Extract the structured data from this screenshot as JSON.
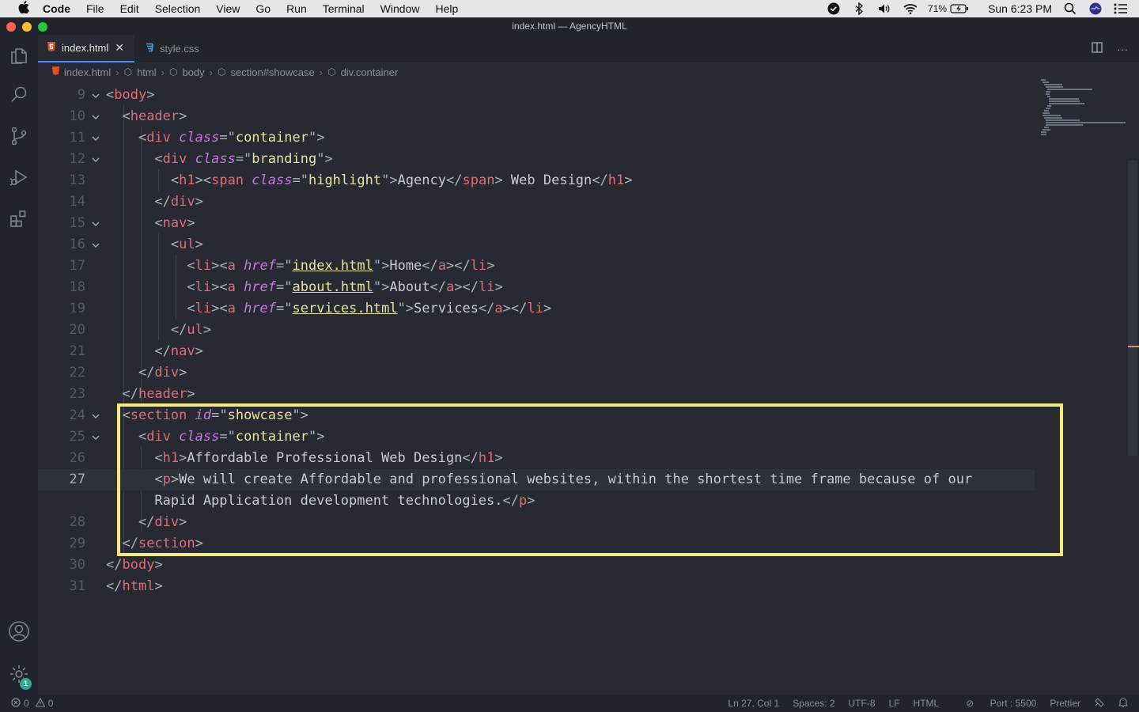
{
  "menubar": {
    "app": "Code",
    "items": [
      "File",
      "Edit",
      "Selection",
      "View",
      "Go",
      "Run",
      "Terminal",
      "Window",
      "Help"
    ],
    "battery": "71%",
    "clock": "Sun 6:23 PM"
  },
  "window": {
    "title": "index.html — AgencyHTML"
  },
  "activity_bar": {
    "items": [
      "explorer-icon",
      "search-icon",
      "source-control-icon",
      "run-debug-icon",
      "extensions-icon"
    ],
    "bottom": [
      "accounts-icon",
      "manage-gear-icon"
    ],
    "badge": "1"
  },
  "tabs": [
    {
      "label": "index.html",
      "icon": "html5-icon",
      "active": true
    },
    {
      "label": "style.css",
      "icon": "css3-icon",
      "active": false
    }
  ],
  "breadcrumb": [
    "index.html",
    "html",
    "body",
    "section#showcase",
    "div.container"
  ],
  "editor": {
    "lines": [
      {
        "num": "9",
        "fold": true,
        "tokens": [
          [
            "p",
            "<"
          ],
          [
            "t",
            "body"
          ],
          [
            "p",
            ">"
          ]
        ]
      },
      {
        "num": "10",
        "fold": true,
        "tokens": [
          [
            "p",
            "  <"
          ],
          [
            "t",
            "header"
          ],
          [
            "p",
            ">"
          ]
        ]
      },
      {
        "num": "11",
        "fold": true,
        "tokens": [
          [
            "p",
            "    <"
          ],
          [
            "t",
            "div"
          ],
          [
            "p",
            " "
          ],
          [
            "a",
            "class"
          ],
          [
            "p",
            "=\""
          ],
          [
            "s",
            "container"
          ],
          [
            "p",
            "\">"
          ]
        ]
      },
      {
        "num": "12",
        "fold": true,
        "tokens": [
          [
            "p",
            "      <"
          ],
          [
            "t",
            "div"
          ],
          [
            "p",
            " "
          ],
          [
            "a",
            "class"
          ],
          [
            "p",
            "=\""
          ],
          [
            "s",
            "branding"
          ],
          [
            "p",
            "\">"
          ]
        ]
      },
      {
        "num": "13",
        "fold": false,
        "tokens": [
          [
            "p",
            "        <"
          ],
          [
            "t",
            "h1"
          ],
          [
            "p",
            "><"
          ],
          [
            "t",
            "span"
          ],
          [
            "p",
            " "
          ],
          [
            "a",
            "class"
          ],
          [
            "p",
            "=\""
          ],
          [
            "s",
            "highlight"
          ],
          [
            "p",
            "\">"
          ],
          [
            "x",
            "Agency"
          ],
          [
            "p",
            "</"
          ],
          [
            "t",
            "span"
          ],
          [
            "p",
            "> "
          ],
          [
            "x",
            "Web Design"
          ],
          [
            "p",
            "</"
          ],
          [
            "t",
            "h1"
          ],
          [
            "p",
            ">"
          ]
        ]
      },
      {
        "num": "14",
        "fold": false,
        "tokens": [
          [
            "p",
            "      </"
          ],
          [
            "t",
            "div"
          ],
          [
            "p",
            ">"
          ]
        ]
      },
      {
        "num": "15",
        "fold": true,
        "tokens": [
          [
            "p",
            "      <"
          ],
          [
            "t",
            "nav"
          ],
          [
            "p",
            ">"
          ]
        ]
      },
      {
        "num": "16",
        "fold": true,
        "tokens": [
          [
            "p",
            "        <"
          ],
          [
            "t",
            "ul"
          ],
          [
            "p",
            ">"
          ]
        ]
      },
      {
        "num": "17",
        "fold": false,
        "tokens": [
          [
            "p",
            "          <"
          ],
          [
            "t",
            "li"
          ],
          [
            "p",
            "><"
          ],
          [
            "t",
            "a"
          ],
          [
            "p",
            " "
          ],
          [
            "a",
            "href"
          ],
          [
            "p",
            "=\""
          ],
          [
            "u",
            "index.html"
          ],
          [
            "p",
            "\">"
          ],
          [
            "x",
            "Home"
          ],
          [
            "p",
            "</"
          ],
          [
            "t",
            "a"
          ],
          [
            "p",
            "></"
          ],
          [
            "t",
            "li"
          ],
          [
            "p",
            ">"
          ]
        ]
      },
      {
        "num": "18",
        "fold": false,
        "tokens": [
          [
            "p",
            "          <"
          ],
          [
            "t",
            "li"
          ],
          [
            "p",
            "><"
          ],
          [
            "t",
            "a"
          ],
          [
            "p",
            " "
          ],
          [
            "a",
            "href"
          ],
          [
            "p",
            "=\""
          ],
          [
            "u",
            "about.html"
          ],
          [
            "p",
            "\">"
          ],
          [
            "x",
            "About"
          ],
          [
            "p",
            "</"
          ],
          [
            "t",
            "a"
          ],
          [
            "p",
            "></"
          ],
          [
            "t",
            "li"
          ],
          [
            "p",
            ">"
          ]
        ]
      },
      {
        "num": "19",
        "fold": false,
        "tokens": [
          [
            "p",
            "          <"
          ],
          [
            "t",
            "li"
          ],
          [
            "p",
            "><"
          ],
          [
            "t",
            "a"
          ],
          [
            "p",
            " "
          ],
          [
            "a",
            "href"
          ],
          [
            "p",
            "=\""
          ],
          [
            "u",
            "services.html"
          ],
          [
            "p",
            "\">"
          ],
          [
            "x",
            "Services"
          ],
          [
            "p",
            "</"
          ],
          [
            "t",
            "a"
          ],
          [
            "p",
            "></"
          ],
          [
            "t",
            "li"
          ],
          [
            "p",
            ">"
          ]
        ]
      },
      {
        "num": "20",
        "fold": false,
        "tokens": [
          [
            "p",
            "        </"
          ],
          [
            "t",
            "ul"
          ],
          [
            "p",
            ">"
          ]
        ]
      },
      {
        "num": "21",
        "fold": false,
        "tokens": [
          [
            "p",
            "      </"
          ],
          [
            "t",
            "nav"
          ],
          [
            "p",
            ">"
          ]
        ]
      },
      {
        "num": "22",
        "fold": false,
        "tokens": [
          [
            "p",
            "    </"
          ],
          [
            "t",
            "div"
          ],
          [
            "p",
            ">"
          ]
        ]
      },
      {
        "num": "23",
        "fold": false,
        "tokens": [
          [
            "p",
            "  </"
          ],
          [
            "t",
            "header"
          ],
          [
            "p",
            ">"
          ]
        ]
      },
      {
        "num": "24",
        "fold": true,
        "tokens": [
          [
            "p",
            "  <"
          ],
          [
            "t",
            "section"
          ],
          [
            "p",
            " "
          ],
          [
            "a",
            "id"
          ],
          [
            "p",
            "=\""
          ],
          [
            "s",
            "showcase"
          ],
          [
            "p",
            "\">"
          ]
        ]
      },
      {
        "num": "25",
        "fold": true,
        "tokens": [
          [
            "p",
            "    <"
          ],
          [
            "t",
            "div"
          ],
          [
            "p",
            " "
          ],
          [
            "a",
            "class"
          ],
          [
            "p",
            "=\""
          ],
          [
            "s",
            "container"
          ],
          [
            "p",
            "\">"
          ]
        ]
      },
      {
        "num": "26",
        "fold": false,
        "tokens": [
          [
            "p",
            "      <"
          ],
          [
            "t",
            "h1"
          ],
          [
            "p",
            ">"
          ],
          [
            "x",
            "Affordable Professional Web Design"
          ],
          [
            "p",
            "</"
          ],
          [
            "t",
            "h1"
          ],
          [
            "p",
            ">"
          ]
        ]
      },
      {
        "num": "27",
        "fold": false,
        "current": true,
        "tokens": [
          [
            "p",
            "      <"
          ],
          [
            "t",
            "p"
          ],
          [
            "p",
            ">"
          ],
          [
            "x",
            "We will create Affordable and professional websites, within the shortest time frame because of our"
          ]
        ]
      },
      {
        "num": "",
        "fold": false,
        "tokens": [
          [
            "x",
            "      Rapid Application development technologies."
          ],
          [
            "p",
            "</"
          ],
          [
            "t",
            "p"
          ],
          [
            "p",
            ">"
          ]
        ]
      },
      {
        "num": "28",
        "fold": false,
        "tokens": [
          [
            "p",
            "    </"
          ],
          [
            "t",
            "div"
          ],
          [
            "p",
            ">"
          ]
        ]
      },
      {
        "num": "29",
        "fold": false,
        "tokens": [
          [
            "p",
            "  </"
          ],
          [
            "t",
            "section"
          ],
          [
            "p",
            ">"
          ]
        ]
      },
      {
        "num": "30",
        "fold": false,
        "tokens": [
          [
            "p",
            "</"
          ],
          [
            "t",
            "body"
          ],
          [
            "p",
            ">"
          ]
        ]
      },
      {
        "num": "31",
        "fold": false,
        "tokens": [
          [
            "p",
            "</"
          ],
          [
            "t",
            "html"
          ],
          [
            "p",
            ">"
          ]
        ]
      }
    ]
  },
  "statusbar": {
    "errors": "0",
    "warnings": "0",
    "position": "Ln 27, Col 1",
    "spaces": "Spaces: 2",
    "encoding": "UTF-8",
    "eol": "LF",
    "language": "HTML",
    "port": "Port : 5500",
    "formatter": "Prettier"
  },
  "colors": {
    "accent": "#528bff",
    "highlight_box": "#f2ea7a",
    "tag": "#e06c75",
    "attribute": "#c678dd",
    "string": "#e5e5a0"
  }
}
